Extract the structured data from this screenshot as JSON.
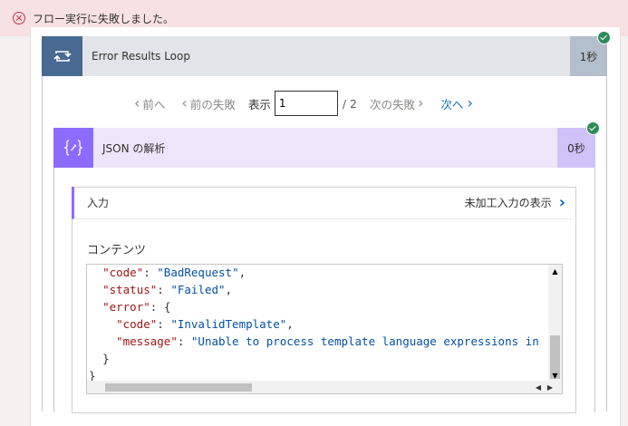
{
  "banner": {
    "message": "フロー実行に失敗しました。"
  },
  "loop": {
    "title": "Error Results Loop",
    "duration": "1秒"
  },
  "pager": {
    "prev": "前へ",
    "prev_failed": "前の失敗",
    "show_label": "表示",
    "current_page": "1",
    "total": "/ 2",
    "next_failed": "次の失敗",
    "next": "次へ"
  },
  "action": {
    "title": "JSON の解析",
    "duration": "0秒"
  },
  "inputs": {
    "header": "入力",
    "raw_link": "未加工入力の表示",
    "contents_label": "コンテンツ"
  },
  "code": {
    "lines": [
      {
        "indent": "  ",
        "key": "\"code\"",
        "sep": ": ",
        "value": "\"BadRequest\"",
        "tail": ","
      },
      {
        "indent": "  ",
        "key": "\"status\"",
        "sep": ": ",
        "value": "\"Failed\"",
        "tail": ","
      },
      {
        "indent": "  ",
        "key": "\"error\"",
        "sep": ": ",
        "value": "",
        "tail": "{"
      },
      {
        "indent": "    ",
        "key": "\"code\"",
        "sep": ": ",
        "value": "\"InvalidTemplate\"",
        "tail": ","
      },
      {
        "indent": "    ",
        "key": "\"message\"",
        "sep": ": ",
        "value": "\"Unable to process template language expressions in",
        "tail": ""
      },
      {
        "indent": "  ",
        "key": "",
        "sep": "",
        "value": "",
        "tail": "}"
      },
      {
        "indent": "",
        "key": "",
        "sep": "",
        "value": "",
        "tail": "}"
      }
    ]
  },
  "colors": {
    "banner_bg": "#f8e1e3",
    "error_red": "#c4314b",
    "loop_accent": "#486991",
    "json_accent": "#8c6cff",
    "success_green": "#2e8b57",
    "link_blue": "#0f6cbd"
  },
  "icons": {
    "banner": "error-circle-icon",
    "loop": "loop-icon",
    "json": "json-braces-icon",
    "status": "checkmark-icon"
  }
}
